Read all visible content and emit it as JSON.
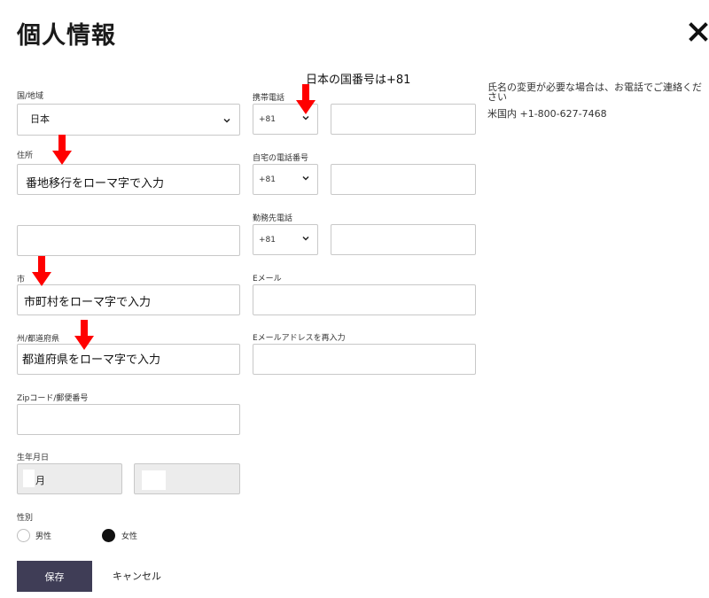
{
  "header": {
    "title": "個人情報",
    "close_icon": "close-icon"
  },
  "annotations": {
    "country_code_note": "日本の国番号は+81",
    "address_hint": "番地移行をローマ字で入力",
    "city_hint": "市町村をローマ字で入力",
    "state_hint": "都道府県をローマ字で入力",
    "arrow_color": "#ff0000"
  },
  "form": {
    "country": {
      "label": "国/地域",
      "value": "日本"
    },
    "address": {
      "label": "住所"
    },
    "city": {
      "label": "市"
    },
    "state": {
      "label": "州/都道府県"
    },
    "zip": {
      "label": "Zipコード/郵便番号"
    },
    "dob": {
      "label": "生年月日",
      "month_value": "月"
    },
    "gender": {
      "label": "性別",
      "options": [
        "男性",
        "女性"
      ],
      "selected": "女性"
    },
    "mobile": {
      "label": "携帯電話",
      "code": "+81"
    },
    "home": {
      "label": "自宅の電話番号",
      "code": "+81"
    },
    "work": {
      "label": "勤務先電話",
      "code": "+81"
    },
    "email": {
      "label": "Eメール"
    },
    "email_confirm": {
      "label": "Eメールアドレスを再入力"
    }
  },
  "side_note": {
    "line1": "氏名の変更が必要な場合は、お電話でご連絡ください",
    "line2": "米国内 +1-800-627-7468"
  },
  "actions": {
    "save": "保存",
    "cancel": "キャンセル"
  },
  "colors": {
    "save_button_bg": "#3f3d56",
    "disabled_field_bg": "#ececec",
    "radio_selected": "#111111"
  }
}
